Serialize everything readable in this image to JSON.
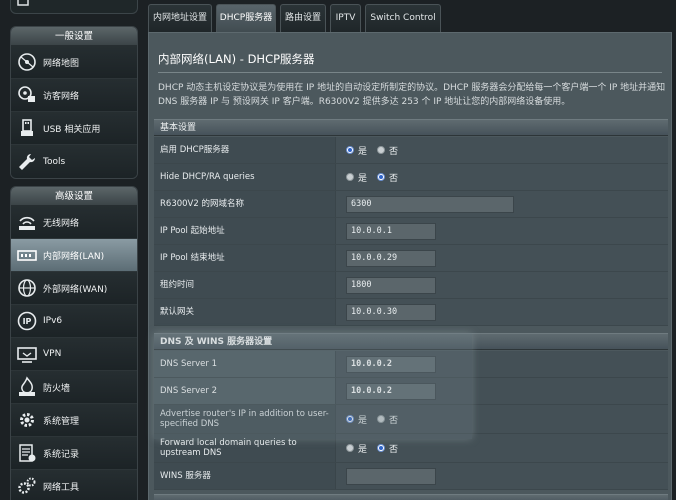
{
  "sidebar": {
    "general_header": "一般设置",
    "general_items": [
      {
        "label": "网络地图",
        "icon": "network-map-icon"
      },
      {
        "label": "访客网络",
        "icon": "guest-network-icon"
      },
      {
        "label": "USB 相关应用",
        "icon": "usb-icon"
      },
      {
        "label": "Tools",
        "icon": "tools-wrench-icon"
      }
    ],
    "advanced_header": "高级设置",
    "advanced_items": [
      {
        "label": "无线网络",
        "icon": "wireless-icon"
      },
      {
        "label": "内部网络(LAN)",
        "icon": "lan-icon",
        "active": true
      },
      {
        "label": "外部网络(WAN)",
        "icon": "wan-globe-icon"
      },
      {
        "label": "IPv6",
        "icon": "ipv6-icon"
      },
      {
        "label": "VPN",
        "icon": "vpn-icon"
      },
      {
        "label": "防火墙",
        "icon": "firewall-icon"
      },
      {
        "label": "系统管理",
        "icon": "administration-gear-icon"
      },
      {
        "label": "系统记录",
        "icon": "system-log-icon"
      },
      {
        "label": "网络工具",
        "icon": "network-tools-gear-icon"
      }
    ]
  },
  "tabs": [
    {
      "label": "内网地址设置",
      "active": false
    },
    {
      "label": "DHCP服务器",
      "active": true
    },
    {
      "label": "路由设置",
      "active": false
    },
    {
      "label": "IPTV",
      "active": false
    },
    {
      "label": "Switch Control",
      "active": false
    }
  ],
  "page": {
    "title": "内部网络(LAN) - DHCP服务器",
    "description": "DHCP 动态主机设定协议是为使用在 IP 地址的自动设定所制定的协议。DHCP 服务器会分配给每一个客户端一个 IP 地址并通知 DNS 服务器 IP 与 预设网关 IP 客户端。R6300V2 提供多达 253 个 IP 地址让您的内部网络设备使用。"
  },
  "basic": {
    "section_title": "基本设置",
    "enable_dhcp": {
      "label": "启用 DHCP服务器",
      "options": [
        "是",
        "否"
      ],
      "selected": "是"
    },
    "hide_dhcp_ra": {
      "label": "Hide DHCP/RA queries",
      "options": [
        "是",
        "否"
      ],
      "selected": "否"
    },
    "domain_name": {
      "label": "R6300V2 的网域名称",
      "value": "6300"
    },
    "pool_start": {
      "label": "IP Pool 起始地址",
      "value": "10.0.0.1"
    },
    "pool_end": {
      "label": "IP Pool 结束地址",
      "value": "10.0.0.29"
    },
    "lease_time": {
      "label": "租约时间",
      "value": "1800"
    },
    "default_gateway": {
      "label": "默认网关",
      "value": "10.0.0.30"
    }
  },
  "dns_wins": {
    "section_title": "DNS 及 WINS 服务器设置",
    "dns1": {
      "label": "DNS Server 1",
      "value": "10.0.0.2"
    },
    "dns2": {
      "label": "DNS Server 2",
      "value": "10.0.0.2"
    },
    "advertise_router_ip": {
      "label": "Advertise router's IP in addition to user-specified DNS",
      "options": [
        "是",
        "否"
      ],
      "selected": "是"
    },
    "forward_local_domain": {
      "label": "Forward local domain queries to upstream DNS",
      "options": [
        "是",
        "否"
      ],
      "selected": "否"
    },
    "wins_server": {
      "label": "WINS 服务器",
      "value": ""
    }
  },
  "colors": {
    "radio_selected": "#2f64c9",
    "active_nav": "#7a8d96",
    "panel_bg": "#4c585d"
  }
}
